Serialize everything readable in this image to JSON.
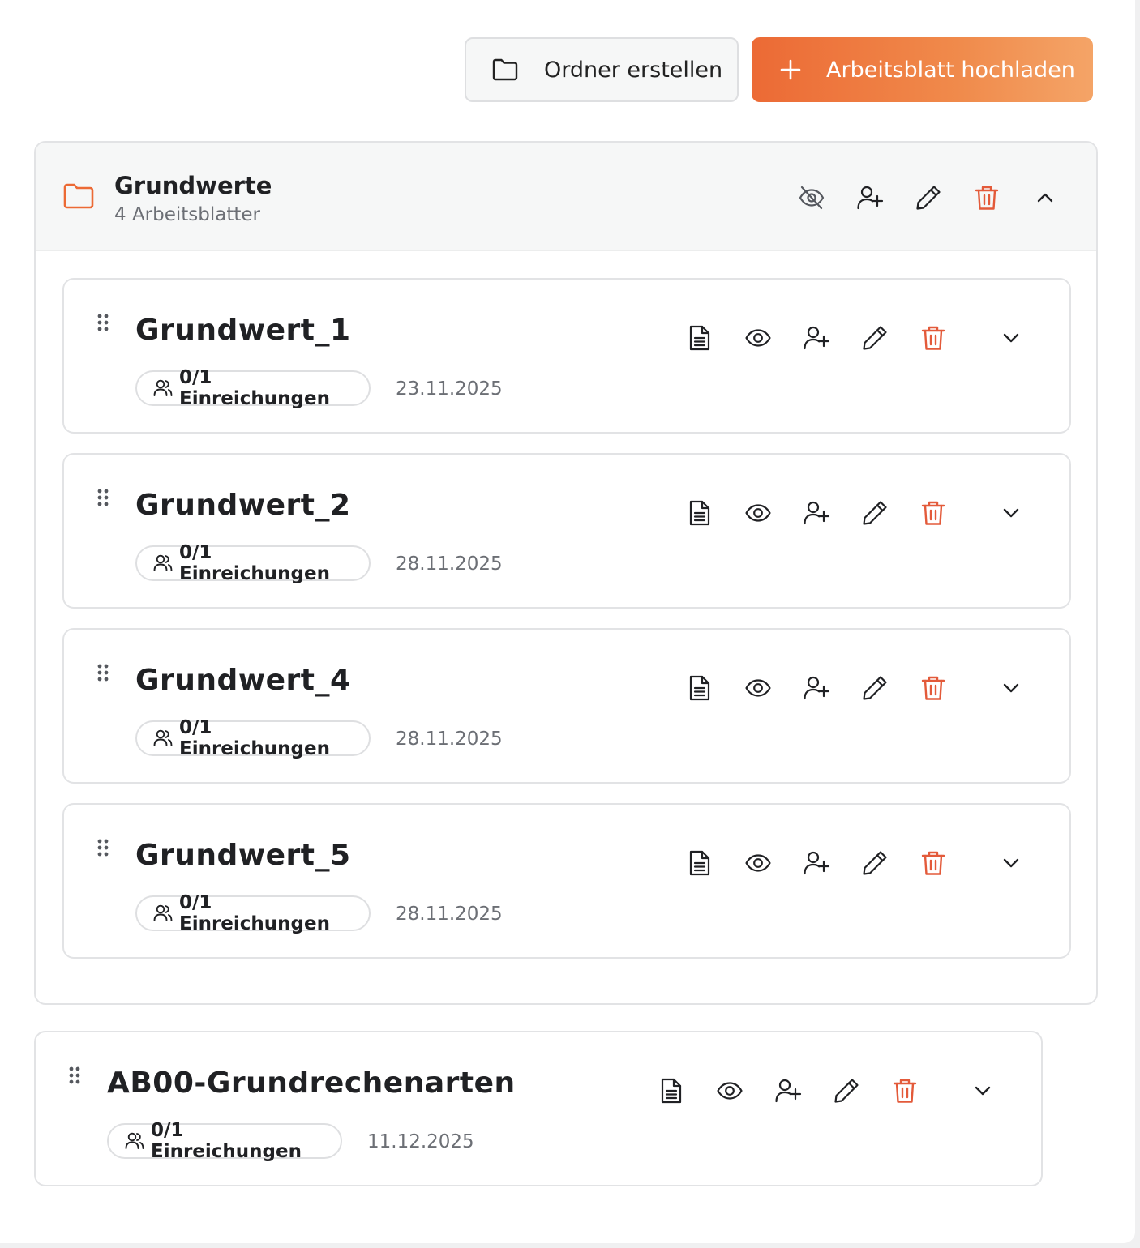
{
  "toolbar": {
    "create_folder_label": "Ordner erstellen",
    "upload_label": "Arbeitsblatt hochladen"
  },
  "folder": {
    "title": "Grundwerte",
    "subtitle": "4 Arbeitsblatter",
    "worksheets": [
      {
        "title": "Grundwert_1",
        "submissions": "0/1 Einreichungen",
        "date": "23.11.2025"
      },
      {
        "title": "Grundwert_2",
        "submissions": "0/1 Einreichungen",
        "date": "28.11.2025"
      },
      {
        "title": "Grundwert_4",
        "submissions": "0/1 Einreichungen",
        "date": "28.11.2025"
      },
      {
        "title": "Grundwert_5",
        "submissions": "0/1 Einreichungen",
        "date": "28.11.2025"
      }
    ]
  },
  "standalone": {
    "title": "AB00-Grundrechenarten",
    "submissions": "0/1 Einreichungen",
    "date": "11.12.2025"
  },
  "colors": {
    "accent": "#ec6a35",
    "danger": "#e35a3a",
    "text": "#202124",
    "muted": "#6c6f75"
  },
  "icons": {
    "document": "document-icon",
    "eye": "eye-icon",
    "eye_off": "eye-off-icon",
    "user_plus": "user-plus-icon",
    "pencil": "pencil-icon",
    "trash": "trash-icon",
    "chevron_down": "chevron-down-icon",
    "chevron_up": "chevron-up-icon",
    "folder": "folder-icon",
    "plus": "plus-icon",
    "users": "users-icon",
    "drag": "drag-handle-icon"
  }
}
